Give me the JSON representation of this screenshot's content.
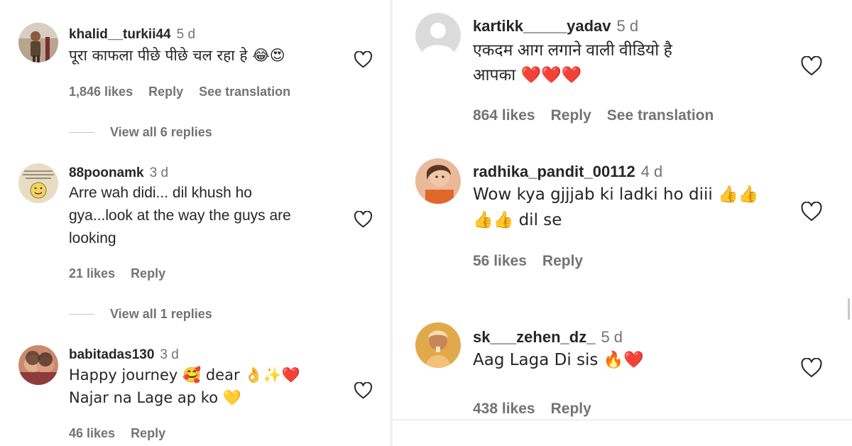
{
  "left_comments": [
    {
      "username": "khalid__turkii44",
      "time": "5 d",
      "text_lines": [
        "पूरा काफला पीछे पीछे चल रहा हे 😂😍"
      ],
      "likes": "1,846 likes",
      "reply": "Reply",
      "translate": "See translation",
      "view_replies": "View all 6 replies"
    },
    {
      "username": "88poonamk",
      "time": "3 d",
      "text_lines": [
        "Arre wah didi... dil khush ho",
        "gya...look at the way the guys are",
        "looking"
      ],
      "likes": "21 likes",
      "reply": "Reply",
      "view_replies": "View all 1 replies"
    },
    {
      "username": "babitadas130",
      "time": "3 d",
      "text_lines": [
        "Happy journey 🥰 dear 👌✨❤️",
        "Najar na Lage ap ko 💛"
      ],
      "likes": "46 likes",
      "reply": "Reply"
    }
  ],
  "right_comments": [
    {
      "username": "kartikk_____yadav",
      "time": "5 d",
      "text_lines": [
        "एकदम आग लगाने वाली वीडियो है",
        "आपका ❤️❤️❤️"
      ],
      "likes": "864 likes",
      "reply": "Reply",
      "translate": "See translation"
    },
    {
      "username": "radhika_pandit_00112",
      "time": "4 d",
      "text_lines": [
        "Wow kya gjjjab ki ladki ho diii 👍👍",
        "👍👍 dil se"
      ],
      "likes": "56 likes",
      "reply": "Reply"
    },
    {
      "username": "sk___zehen_dz_",
      "time": "5 d",
      "text_lines": [
        "Aag Laga Di sis 🔥❤️"
      ],
      "likes": "438 likes",
      "reply": "Reply"
    }
  ],
  "icons": {
    "like": "heart-outline-icon",
    "default_avatar": "person-silhouette-icon"
  },
  "colors": {
    "text": "#262626",
    "secondary": "#737373",
    "divider": "#efefef",
    "background": "#ffffff"
  }
}
